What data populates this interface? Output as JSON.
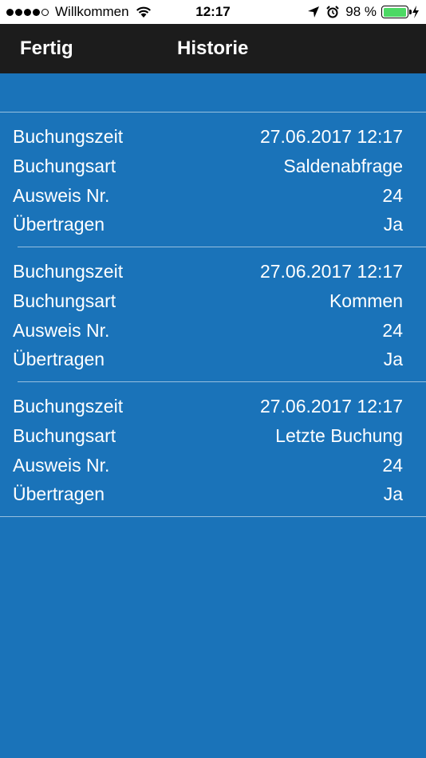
{
  "status_bar": {
    "carrier": "Willkommen",
    "time": "12:17",
    "battery_percent": "98 %",
    "battery_level": 0.98,
    "signal_bars_filled": 4,
    "signal_bars_total": 5,
    "icons": [
      "wifi-icon",
      "location-arrow-icon",
      "alarm-icon",
      "battery-icon",
      "charging-bolt-icon"
    ]
  },
  "nav": {
    "done_label": "Fertig",
    "title": "Historie"
  },
  "colors": {
    "background": "#1a73b9",
    "nav_background": "#1c1c1c",
    "battery_fill": "#4cd964"
  },
  "entries": [
    {
      "rows": [
        {
          "label": "Buchungszeit",
          "value": "27.06.2017 12:17"
        },
        {
          "label": "Buchungsart",
          "value": "Saldenabfrage"
        },
        {
          "label": "Ausweis Nr.",
          "value": "24"
        },
        {
          "label": "Übertragen",
          "value": "Ja"
        }
      ]
    },
    {
      "rows": [
        {
          "label": "Buchungszeit",
          "value": "27.06.2017 12:17"
        },
        {
          "label": "Buchungsart",
          "value": "Kommen"
        },
        {
          "label": "Ausweis Nr.",
          "value": "24"
        },
        {
          "label": "Übertragen",
          "value": "Ja"
        }
      ]
    },
    {
      "rows": [
        {
          "label": "Buchungszeit",
          "value": "27.06.2017 12:17"
        },
        {
          "label": "Buchungsart",
          "value": "Letzte Buchung"
        },
        {
          "label": "Ausweis Nr.",
          "value": "24"
        },
        {
          "label": "Übertragen",
          "value": "Ja"
        }
      ]
    }
  ]
}
